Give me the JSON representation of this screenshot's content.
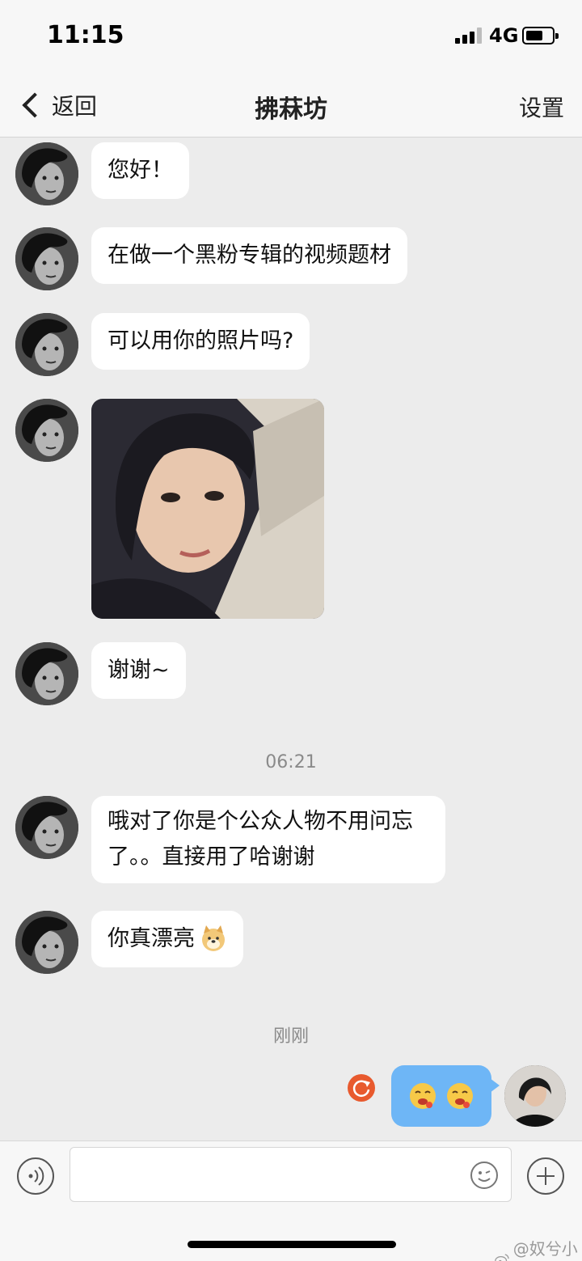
{
  "status_bar": {
    "time": "11:15",
    "network": "4G"
  },
  "nav": {
    "back_label": "返回",
    "title": "拂菻坊",
    "settings_label": "设置"
  },
  "messages": [
    {
      "text": "您好！"
    },
    {
      "text": "在做一个黑粉专辑的视频题材"
    },
    {
      "text": "可以用你的照片吗?"
    },
    {
      "text": "谢谢~"
    },
    {
      "text": "哦对了你是个公众人物不用问忘了。。直接用了哈谢谢"
    },
    {
      "text": "你真漂亮"
    }
  ],
  "timestamps": {
    "first": "06:21",
    "second": "刚刚"
  },
  "input": {
    "placeholder": ""
  },
  "watermark": "@奴兮小姐",
  "colors": {
    "outgoing_bubble": "#6eb6f6",
    "resend_badge": "#e85a2e",
    "chat_background": "#ececec"
  }
}
